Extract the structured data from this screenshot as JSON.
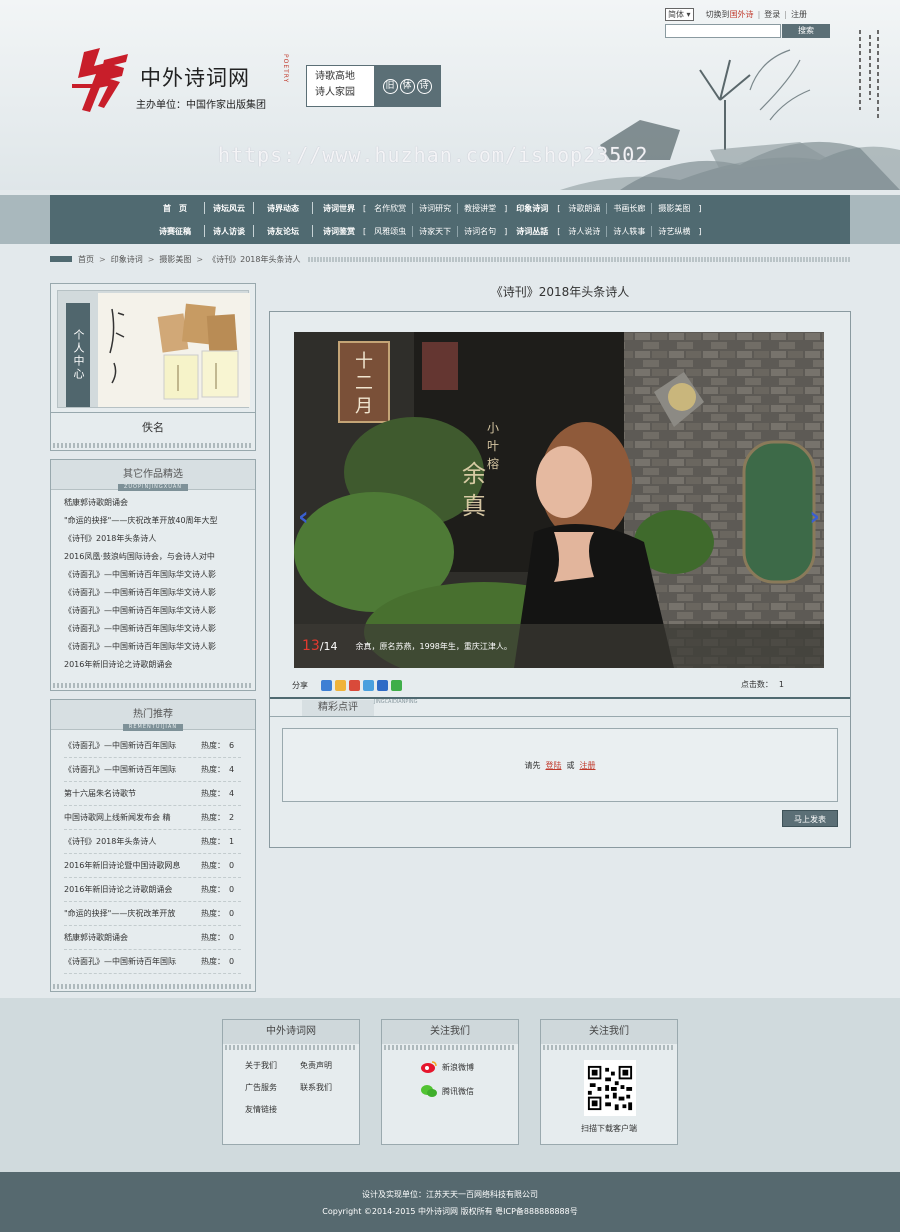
{
  "header": {
    "site_title": "中外诗词网",
    "sponsor": "主办单位：中国作家出版集团",
    "vertical_text": "POETRY",
    "slogan_line1": "诗歌高地",
    "slogan_line2": "诗人家园",
    "slogan_badge": [
      "旧",
      "体",
      "诗"
    ],
    "watermark": "https://www.huzhan.com/ishop23502",
    "lang_value": "简体 ▾",
    "switch_prefix": "切换到",
    "switch_target": "国外诗",
    "login": "登录",
    "register": "注册",
    "search_placeholder": "",
    "search_button": "搜索"
  },
  "nav": {
    "row1": {
      "home": "首　页",
      "items": [
        "诗坛风云",
        "诗界动态",
        "诗词世界"
      ],
      "subs": [
        "名作欣赏",
        "诗词研究",
        "教授讲堂"
      ],
      "group2": "印象诗词",
      "subs2": [
        "诗歌朗诵",
        "书画长廊",
        "摄影美图"
      ]
    },
    "row2": {
      "items": [
        "诗赛征稿",
        "诗人访谈",
        "诗友论坛",
        "诗词鉴赏"
      ],
      "subs": [
        "风雅颂虫",
        "诗家天下",
        "诗词名句"
      ],
      "group2": "诗词丛話",
      "subs2": [
        "诗人说诗",
        "诗人轶事",
        "诗艺纵横"
      ]
    }
  },
  "breadcrumb": [
    "首页",
    "印象诗词",
    "摄影美图",
    "《诗刊》2018年头条诗人"
  ],
  "profile": {
    "tab_label": "个人中心",
    "name": "佚名"
  },
  "works": {
    "title": "其它作品精选",
    "subtitle": "ZUOPINJINGXUAN",
    "items": [
      "嵇康郭诗歌朗诵会",
      "\"命运的抉择\"——庆祝改革开放40周年大型",
      "《诗刊》2018年头条诗人",
      "2016凤凰·鼓浪屿国际诗会，与会诗人对中",
      "《诗面孔》—中国新诗百年国际华文诗人影",
      "《诗面孔》—中国新诗百年国际华文诗人影",
      "《诗面孔》—中国新诗百年国际华文诗人影",
      "《诗面孔》—中国新诗百年国际华文诗人影",
      "《诗面孔》—中国新诗百年国际华文诗人影",
      "2016年新旧诗论之诗歌朗诵会"
    ]
  },
  "hot": {
    "title": "热门推荐",
    "subtitle": "REMENTUIJIAN",
    "heat_label": "热度：",
    "items": [
      {
        "title": "《诗面孔》—中国新诗百年国际",
        "heat": "6"
      },
      {
        "title": "《诗面孔》—中国新诗百年国际",
        "heat": "4"
      },
      {
        "title": "第十六届朱名诗歌节",
        "heat": "4"
      },
      {
        "title": "中国诗歌网上线新闻发布会 精",
        "heat": "2"
      },
      {
        "title": "《诗刊》2018年头条诗人",
        "heat": "1"
      },
      {
        "title": "2016年新旧诗论暨中国诗歌网息",
        "heat": "0"
      },
      {
        "title": "2016年新旧诗论之诗歌朗诵会",
        "heat": "0"
      },
      {
        "title": "\"命运的抉择\"——庆祝改革开放",
        "heat": "0"
      },
      {
        "title": "嵇康郭诗歌朗诵会",
        "heat": "0"
      },
      {
        "title": "《诗面孔》—中国新诗百年国际",
        "heat": "0"
      }
    ]
  },
  "main": {
    "title": "《诗刊》2018年头条诗人",
    "photo_sign": "十二月",
    "photo_overlay": "余真",
    "photo_overlay_small": "小叶榕",
    "caption_current": "13",
    "caption_total": "/14",
    "caption_text": "余真，原名苏燕，1998年生，重庆江津人。",
    "share_label": "分享",
    "click_label": "点击数：",
    "click_count": "1",
    "comment_title": "精彩点评",
    "comment_subtitle": "JINGCAIDIANPING",
    "comment_prompt": "请先",
    "comment_login": "登陆",
    "comment_or": "或",
    "comment_register": "注册",
    "submit": "马上发表"
  },
  "footer": {
    "box1_title": "中外诗词网",
    "box1_links": [
      "关于我们",
      "免责声明",
      "广告服务",
      "联系我们",
      "友情链接"
    ],
    "box2_title": "关注我们",
    "weibo": "新浪微博",
    "weixin": "腾讯微信",
    "box3_title": "关注我们",
    "qr_caption": "扫描下载客户端",
    "design_line": "设计及实现单位：江苏天天一百网络科技有限公司",
    "copyright_line": "Copyright ©2014-2015 中外诗词网 版权所有 粤ICP备888888888号"
  },
  "colors": {
    "accent": "#506a71",
    "link_red": "#c0392b",
    "arrow_blue": "#3a5fd0"
  }
}
